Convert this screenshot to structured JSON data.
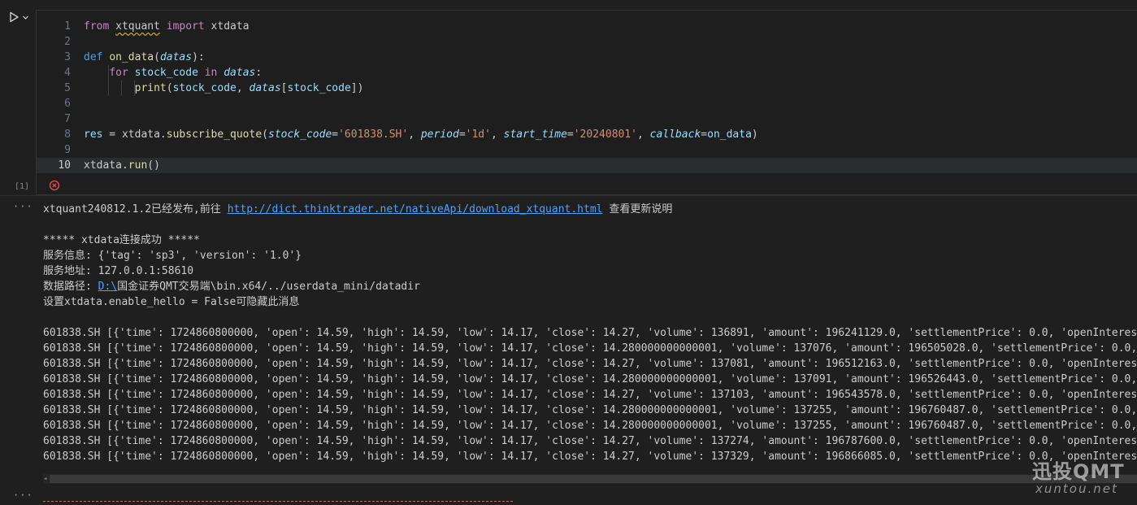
{
  "cell": {
    "exec_count": "[1]",
    "code_lines": [
      {
        "n": "1",
        "html": "<span class=\"kw\">from</span> <span class=\"squig\">xtquant</span> <span class=\"kw\">import</span> xtdata"
      },
      {
        "n": "2",
        "html": ""
      },
      {
        "n": "3",
        "html": "<span class=\"kw2\">def</span> <span class=\"fn\">on_data</span>(<span class=\"prm\">datas</span>):"
      },
      {
        "n": "4",
        "html": "    <span class=\"kw\">for</span> <span class=\"var\">stock_code</span> <span class=\"kw\">in</span> <span class=\"prm\">datas</span>:"
      },
      {
        "n": "5",
        "html": "        <span class=\"bi\">print</span>(<span class=\"var\">stock_code</span>, <span class=\"prm\">datas</span>[<span class=\"var\">stock_code</span>])"
      },
      {
        "n": "6",
        "html": ""
      },
      {
        "n": "7",
        "html": ""
      },
      {
        "n": "8",
        "html": "<span class=\"var\">res</span> = xtdata.<span class=\"fn\">subscribe_quote</span>(<span class=\"prm\">stock_code</span>=<span class=\"str\">'601838.SH'</span>, <span class=\"prm\">period</span>=<span class=\"str\">'1d'</span>, <span class=\"prm\">start_time</span>=<span class=\"str\">'20240801'</span>, <span class=\"prm\">callback</span>=<span class=\"var\">on_data</span>)"
      },
      {
        "n": "9",
        "html": ""
      },
      {
        "n": "10",
        "html": "xtdata.<span class=\"fn\">run</span>()"
      }
    ]
  },
  "output": {
    "dots": "···",
    "line1_text": "xtquant240812.1.2已经发布,前往 ",
    "line1_link": "http://dict.thinktrader.net/nativeApi/download_xtquant.html",
    "line1_tail": " 查看更新说明",
    "connect": "***** xtdata连接成功 *****",
    "service_info": "服务信息: {'tag': 'sp3', 'version': '1.0'}",
    "service_addr": "服务地址: 127.0.0.1:58610",
    "data_path_label": "数据路径: ",
    "data_path_link": "D:\\",
    "data_path_rest": "国金证券QMT交易端\\bin.x64/../userdata_mini/datadir",
    "hint": "设置xtdata.enable_hello = False可隐藏此消息",
    "data_lines": [
      "601838.SH [{'time': 1724860800000, 'open': 14.59, 'high': 14.59, 'low': 14.17, 'close': 14.27, 'volume': 136891, 'amount': 196241129.0, 'settlementPrice': 0.0, 'openInterest':",
      "601838.SH [{'time': 1724860800000, 'open': 14.59, 'high': 14.59, 'low': 14.17, 'close': 14.280000000000001, 'volume': 137076, 'amount': 196505028.0, 'settlementPrice': 0.0, 'o",
      "601838.SH [{'time': 1724860800000, 'open': 14.59, 'high': 14.59, 'low': 14.17, 'close': 14.27, 'volume': 137081, 'amount': 196512163.0, 'settlementPrice': 0.0, 'openInterest':",
      "601838.SH [{'time': 1724860800000, 'open': 14.59, 'high': 14.59, 'low': 14.17, 'close': 14.280000000000001, 'volume': 137091, 'amount': 196526443.0, 'settlementPrice': 0.0, 'o",
      "601838.SH [{'time': 1724860800000, 'open': 14.59, 'high': 14.59, 'low': 14.17, 'close': 14.27, 'volume': 137103, 'amount': 196543578.0, 'settlementPrice': 0.0, 'openInterest':",
      "601838.SH [{'time': 1724860800000, 'open': 14.59, 'high': 14.59, 'low': 14.17, 'close': 14.280000000000001, 'volume': 137255, 'amount': 196760487.0, 'settlementPrice': 0.0, 'o",
      "601838.SH [{'time': 1724860800000, 'open': 14.59, 'high': 14.59, 'low': 14.17, 'close': 14.280000000000001, 'volume': 137255, 'amount': 196760487.0, 'settlementPrice': 0.0, 'o",
      "601838.SH [{'time': 1724860800000, 'open': 14.59, 'high': 14.59, 'low': 14.17, 'close': 14.27, 'volume': 137274, 'amount': 196787600.0, 'settlementPrice': 0.0, 'openInterest':",
      "601838.SH [{'time': 1724860800000, 'open': 14.59, 'high': 14.59, 'low': 14.17, 'close': 14.27, 'volume': 137329, 'amount': 196866085.0, 'settlementPrice': 0.0, 'openInterest':"
    ]
  },
  "watermark": {
    "brand": "迅投QMT",
    "site": "xuntou.net"
  },
  "colors": {
    "background": "#1f1f1f",
    "link": "#4aa3ff",
    "keyword": "#c586c0",
    "string": "#ce9178",
    "error": "#f14c4c"
  },
  "icons": {
    "run": "play-icon",
    "run_menu": "chevron-down-icon",
    "status": "error-circle-icon"
  }
}
